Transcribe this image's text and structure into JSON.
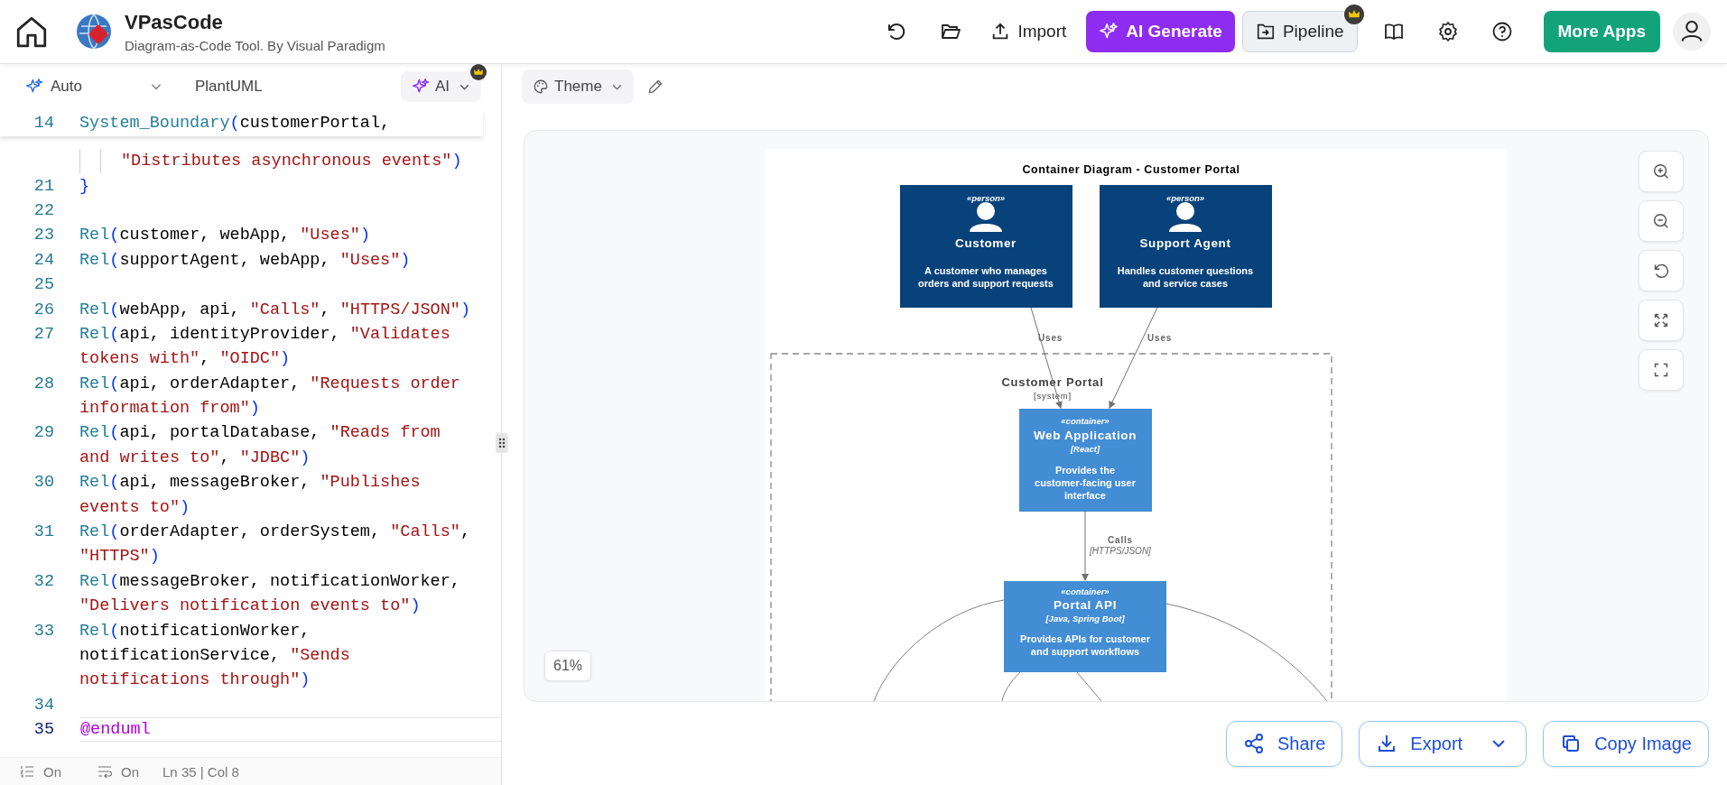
{
  "app": {
    "title": "VPasCode",
    "subtitle": "Diagram-as-Code Tool. By Visual Paradigm"
  },
  "header_buttons": {
    "import": "Import",
    "ai_generate": "AI Generate",
    "pipeline": "Pipeline",
    "more_apps": "More Apps"
  },
  "editor_toolbar": {
    "mode": "Auto",
    "language": "PlantUML",
    "ai": "AI"
  },
  "canvas_toolbar": {
    "theme": "Theme"
  },
  "code": {
    "sticky": {
      "number": "14",
      "segments": [
        {
          "kind": "func",
          "text": "System_Boundary"
        },
        {
          "kind": "paren",
          "text": "("
        },
        {
          "kind": "plain",
          "text": "customerPortal,"
        }
      ]
    },
    "lines": [
      {
        "kind": "nested",
        "current": false,
        "segments": [
          {
            "kind": "string",
            "text": "\"Distributes asynchronous events\""
          },
          {
            "kind": "paren",
            "text": ")"
          }
        ]
      },
      {
        "number": "21",
        "kind": "plain",
        "current": false,
        "segments": [
          {
            "kind": "paren",
            "text": "}"
          }
        ]
      },
      {
        "number": "22",
        "kind": "plain",
        "current": false
      },
      {
        "number": "23",
        "kind": "plain",
        "current": false,
        "segments": [
          {
            "kind": "func",
            "text": "Rel"
          },
          {
            "kind": "paren",
            "text": "("
          },
          {
            "kind": "plain",
            "text": "customer, webApp, "
          },
          {
            "kind": "string",
            "text": "\"Uses\""
          },
          {
            "kind": "paren",
            "text": ")"
          }
        ]
      },
      {
        "number": "24",
        "kind": "plain",
        "current": false,
        "segments": [
          {
            "kind": "func",
            "text": "Rel"
          },
          {
            "kind": "paren",
            "text": "("
          },
          {
            "kind": "plain",
            "text": "supportAgent, webApp, "
          },
          {
            "kind": "string",
            "text": "\"Uses\""
          },
          {
            "kind": "paren",
            "text": ")"
          }
        ]
      },
      {
        "number": "25",
        "kind": "plain",
        "current": false
      },
      {
        "number": "26",
        "kind": "plain",
        "current": false,
        "segments": [
          {
            "kind": "func",
            "text": "Rel"
          },
          {
            "kind": "paren",
            "text": "("
          },
          {
            "kind": "plain",
            "text": "webApp, api, "
          },
          {
            "kind": "string",
            "text": "\"Calls\""
          },
          {
            "kind": "plain",
            "text": ", "
          },
          {
            "kind": "string",
            "text": "\"HTTPS/JSON\""
          },
          {
            "kind": "paren",
            "text": ")"
          }
        ]
      },
      {
        "number": "27",
        "kind": "plain",
        "current": false,
        "segments": [
          {
            "kind": "func",
            "text": "Rel"
          },
          {
            "kind": "paren",
            "text": "("
          },
          {
            "kind": "plain",
            "text": "api, identityProvider, "
          },
          {
            "kind": "string",
            "text": "\"Validates"
          }
        ]
      },
      {
        "kind": "plain",
        "current": false,
        "segments": [
          {
            "kind": "string",
            "text": "tokens with\""
          },
          {
            "kind": "plain",
            "text": ", "
          },
          {
            "kind": "string",
            "text": "\"OIDC\""
          },
          {
            "kind": "paren",
            "text": ")"
          }
        ]
      },
      {
        "number": "28",
        "kind": "plain",
        "current": false,
        "segments": [
          {
            "kind": "func",
            "text": "Rel"
          },
          {
            "kind": "paren",
            "text": "("
          },
          {
            "kind": "plain",
            "text": "api, orderAdapter, "
          },
          {
            "kind": "string",
            "text": "\"Requests order"
          }
        ]
      },
      {
        "kind": "plain",
        "current": false,
        "segments": [
          {
            "kind": "string",
            "text": "information from\""
          },
          {
            "kind": "paren",
            "text": ")"
          }
        ]
      },
      {
        "number": "29",
        "kind": "plain",
        "current": false,
        "segments": [
          {
            "kind": "func",
            "text": "Rel"
          },
          {
            "kind": "paren",
            "text": "("
          },
          {
            "kind": "plain",
            "text": "api, portalDatabase, "
          },
          {
            "kind": "string",
            "text": "\"Reads from"
          }
        ]
      },
      {
        "kind": "plain",
        "current": false,
        "segments": [
          {
            "kind": "string",
            "text": "and writes to\""
          },
          {
            "kind": "plain",
            "text": ", "
          },
          {
            "kind": "string",
            "text": "\"JDBC\""
          },
          {
            "kind": "paren",
            "text": ")"
          }
        ]
      },
      {
        "number": "30",
        "kind": "plain",
        "current": false,
        "segments": [
          {
            "kind": "func",
            "text": "Rel"
          },
          {
            "kind": "paren",
            "text": "("
          },
          {
            "kind": "plain",
            "text": "api, messageBroker, "
          },
          {
            "kind": "string",
            "text": "\"Publishes"
          }
        ]
      },
      {
        "kind": "plain",
        "current": false,
        "segments": [
          {
            "kind": "string",
            "text": "events to\""
          },
          {
            "kind": "paren",
            "text": ")"
          }
        ]
      },
      {
        "number": "31",
        "kind": "plain",
        "current": false,
        "segments": [
          {
            "kind": "func",
            "text": "Rel"
          },
          {
            "kind": "paren",
            "text": "("
          },
          {
            "kind": "plain",
            "text": "orderAdapter, orderSystem, "
          },
          {
            "kind": "string",
            "text": "\"Calls\""
          },
          {
            "kind": "plain",
            "text": ","
          }
        ]
      },
      {
        "kind": "plain",
        "current": false,
        "segments": [
          {
            "kind": "string",
            "text": "\"HTTPS\""
          },
          {
            "kind": "paren",
            "text": ")"
          }
        ]
      },
      {
        "number": "32",
        "kind": "plain",
        "current": false,
        "segments": [
          {
            "kind": "func",
            "text": "Rel"
          },
          {
            "kind": "paren",
            "text": "("
          },
          {
            "kind": "plain",
            "text": "messageBroker, notificationWorker,"
          }
        ]
      },
      {
        "kind": "plain",
        "current": false,
        "segments": [
          {
            "kind": "string",
            "text": "\"Delivers notification events to\""
          },
          {
            "kind": "paren",
            "text": ")"
          }
        ]
      },
      {
        "number": "33",
        "kind": "plain",
        "current": false,
        "segments": [
          {
            "kind": "func",
            "text": "Rel"
          },
          {
            "kind": "paren",
            "text": "("
          },
          {
            "kind": "plain",
            "text": "notificationWorker,"
          }
        ]
      },
      {
        "kind": "plain",
        "current": false,
        "segments": [
          {
            "kind": "plain",
            "text": "notificationService, "
          },
          {
            "kind": "string",
            "text": "\"Sends"
          }
        ]
      },
      {
        "kind": "plain",
        "current": false,
        "segments": [
          {
            "kind": "string",
            "text": "notifications through\""
          },
          {
            "kind": "paren",
            "text": ")"
          }
        ]
      },
      {
        "number": "34",
        "kind": "plain",
        "current": false
      },
      {
        "number": "35",
        "kind": "plain",
        "current": true,
        "segments": [
          {
            "kind": "directive",
            "text": "@enduml"
          }
        ]
      }
    ]
  },
  "status_bar": {
    "line_numbers": "On",
    "word_wrap": "On",
    "position": "Ln 35 | Col 8"
  },
  "diagram": {
    "title": "Container Diagram - Customer Portal",
    "people": [
      {
        "stereotype": "«person»",
        "name": "Customer",
        "description": [
          "A customer who manages",
          "orders and support requests"
        ]
      },
      {
        "stereotype": "«person»",
        "name": "Support Agent",
        "description": [
          "Handles customer questions",
          "and service cases"
        ]
      }
    ],
    "boundary": {
      "name": "Customer Portal",
      "type": "[system]"
    },
    "containers": [
      {
        "stereotype": "«container»",
        "name": "Web Application",
        "technology": "[React]",
        "description": [
          "Provides the",
          "customer-facing user",
          "interface"
        ]
      },
      {
        "stereotype": "«container»",
        "name": "Portal API",
        "technology": "[Java, Spring Boot]",
        "description": [
          "Provides APIs for customer",
          "and support workflows"
        ]
      }
    ],
    "relations": [
      {
        "label": "Uses"
      },
      {
        "label": "Uses"
      },
      {
        "label": "Calls",
        "technology": "[HTTPS/JSON]"
      }
    ]
  },
  "zoom": "61%",
  "actions": {
    "share": "Share",
    "export": "Export",
    "copy_image": "Copy Image"
  }
}
